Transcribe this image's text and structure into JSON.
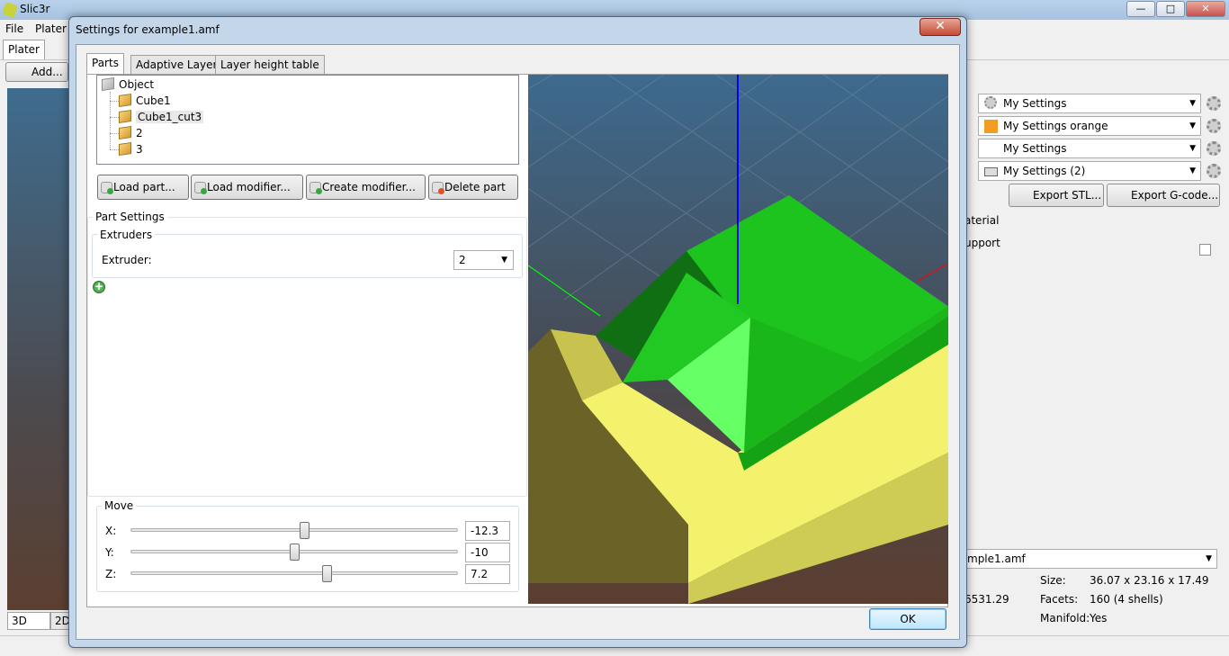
{
  "main_window": {
    "title": "Slic3r",
    "menus": [
      "File",
      "Plater"
    ],
    "tab_plater": "Plater",
    "add_label": "Add...",
    "view_tab_3d": "3D",
    "view_tab_2d": "2D",
    "controls": {
      "minimize": "—",
      "maximize": "□",
      "close": "✕"
    },
    "presets": [
      {
        "label": "My Settings",
        "icon": "gear-icon"
      },
      {
        "label": "My Settings orange",
        "icon": "color-swatch-icon",
        "color": "#f39c24"
      },
      {
        "label": "My Settings",
        "icon": ""
      },
      {
        "label": "My Settings (2)",
        "icon": "printer-icon"
      }
    ],
    "export_stl": "Export STL...",
    "export_gcode": "Export G-code...",
    "material_label": "aterial",
    "support_label": "upport",
    "object_combo": "mple1.amf",
    "info": {
      "size_label": "Size:",
      "size_value": "36.07 x 23.16 x 17.49",
      "volume_partial": "6531.29",
      "facets_label": "Facets:",
      "facets_value": "160 (4 shells)",
      "manifold_label": "Manifold:",
      "manifold_value": "Yes"
    }
  },
  "dialog": {
    "title": "Settings for example1.amf",
    "close_glyph": "✕",
    "tabs": [
      "Parts",
      "Adaptive Layers",
      "Layer height table"
    ],
    "tree": {
      "root": "Object",
      "items": [
        "Cube1",
        "Cube1_cut3",
        "2",
        "3"
      ]
    },
    "buttons": {
      "load_part": "Load part...",
      "load_modifier": "Load modifier...",
      "create_modifier": "Create modifier...",
      "delete_part": "Delete part"
    },
    "part_settings": {
      "title": "Part Settings",
      "extruders_group": "Extruders",
      "extruder_label": "Extruder:",
      "extruder_value": "2",
      "add_glyph": "+"
    },
    "move": {
      "title": "Move",
      "x_label": "X:",
      "x_value": "-12.3",
      "x_pos": 0.53,
      "y_label": "Y:",
      "y_value": "-10",
      "y_pos": 0.5,
      "z_label": "Z:",
      "z_value": "7.2",
      "z_pos": 0.6
    },
    "ok_label": "OK"
  },
  "colors": {
    "viewport_top": "#3d6a8e",
    "viewport_bottom": "#5b3e30",
    "part_green": "#1ec41e",
    "part_yellow": "#f4f26c",
    "axis_z": "#0000ff",
    "axis_x": "#ff0000",
    "axis_y": "#00ff00"
  }
}
